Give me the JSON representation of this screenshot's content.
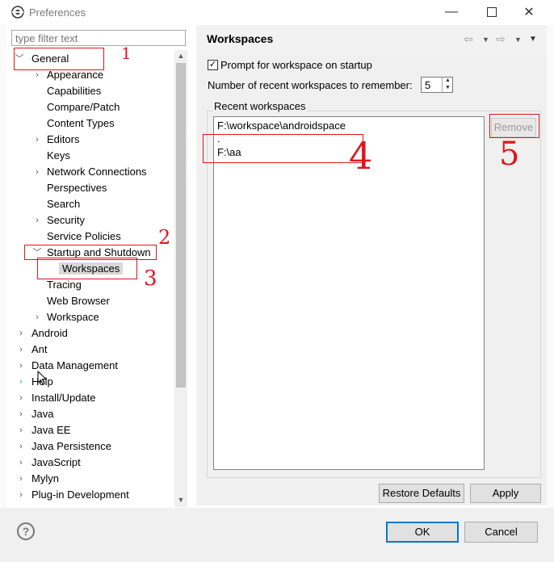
{
  "window": {
    "title": "Preferences",
    "controls": [
      "minimize-icon",
      "maximize-icon",
      "close-icon"
    ]
  },
  "filter": {
    "placeholder": "type filter text"
  },
  "tree": {
    "items": [
      {
        "label": "General",
        "expanded": true
      },
      {
        "label": "Appearance"
      },
      {
        "label": "Capabilities"
      },
      {
        "label": "Compare/Patch"
      },
      {
        "label": "Content Types"
      },
      {
        "label": "Editors"
      },
      {
        "label": "Keys"
      },
      {
        "label": "Network Connections"
      },
      {
        "label": "Perspectives"
      },
      {
        "label": "Search"
      },
      {
        "label": "Security"
      },
      {
        "label": "Service Policies"
      },
      {
        "label": "Startup and Shutdown",
        "expanded": true
      },
      {
        "label": "Workspaces",
        "selected": true
      },
      {
        "label": "Tracing"
      },
      {
        "label": "Web Browser"
      },
      {
        "label": "Workspace"
      },
      {
        "label": "Android"
      },
      {
        "label": "Ant"
      },
      {
        "label": "Data Management"
      },
      {
        "label": "Help"
      },
      {
        "label": "Install/Update"
      },
      {
        "label": "Java"
      },
      {
        "label": "Java EE"
      },
      {
        "label": "Java Persistence"
      },
      {
        "label": "JavaScript"
      },
      {
        "label": "Mylyn"
      },
      {
        "label": "Plug-in Development"
      }
    ]
  },
  "page": {
    "title": "Workspaces",
    "prompt_label": "Prompt for workspace on startup",
    "prompt_checked": true,
    "recent_count_label": "Number of recent workspaces to remember:",
    "recent_count_value": "5",
    "group_label": "Recent workspaces",
    "recent_list": [
      "F:\\workspace\\androidspace",
      ".",
      "F:\\aa"
    ],
    "remove_label": "Remove",
    "restore_label": "Restore Defaults",
    "apply_label": "Apply"
  },
  "footer": {
    "ok_label": "OK",
    "cancel_label": "Cancel",
    "help_glyph": "?"
  },
  "annotations": {
    "n1": "1",
    "n2": "2",
    "n3": "3",
    "n4": "4",
    "n5": "5"
  },
  "colors": {
    "annotation_red": "#e0151b",
    "accent_blue": "#0078d7"
  }
}
